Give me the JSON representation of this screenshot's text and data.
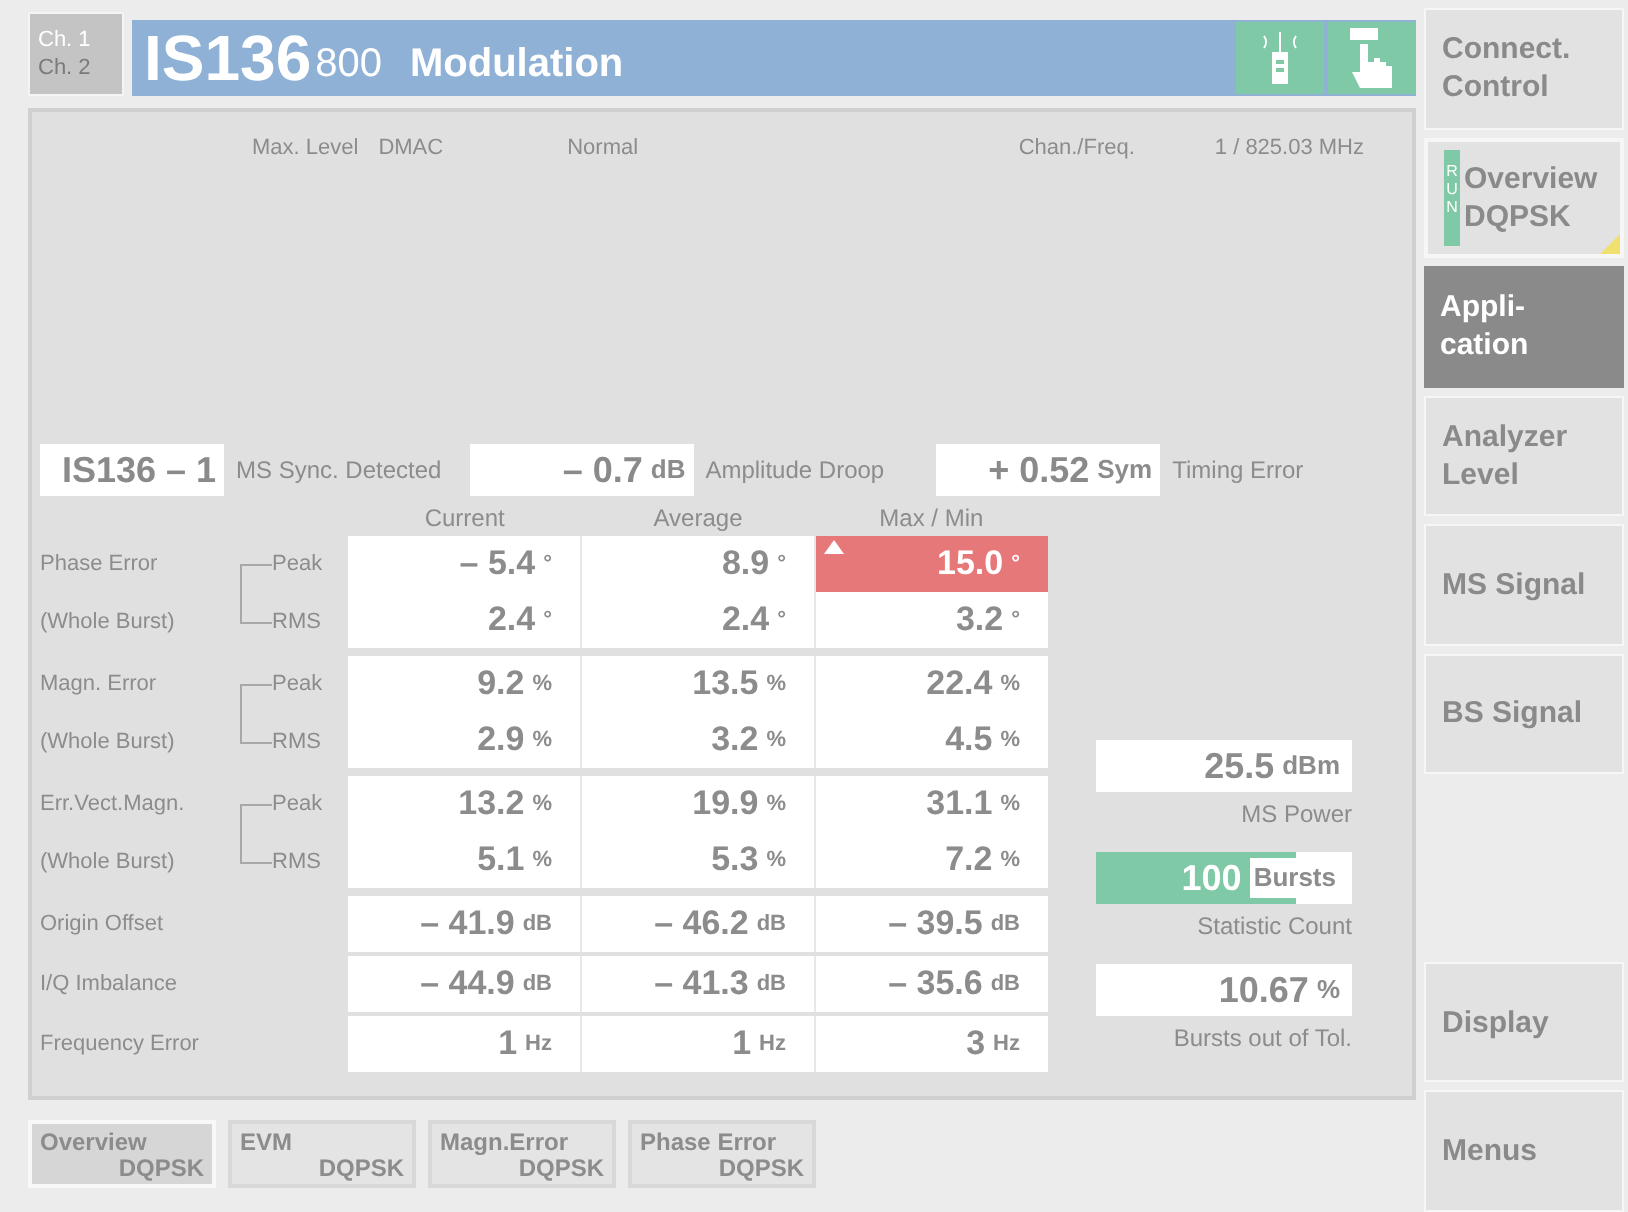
{
  "channels": [
    {
      "label": "Ch. 1",
      "selected": true
    },
    {
      "label": "Ch. 2",
      "selected": false
    }
  ],
  "title": {
    "standard": "IS136",
    "band": "800",
    "mode": "Modulation"
  },
  "info": [
    {
      "label": "Max. Level",
      "value": "DMAC"
    },
    {
      "value": "Normal"
    },
    {
      "label": "Chan./Freq.",
      "value": "1 / 825.03 MHz"
    }
  ],
  "status_line": [
    {
      "value": "IS136 – 1",
      "caption": "MS Sync. Detected"
    },
    {
      "value": "– 0.7",
      "unit": "dB",
      "caption": "Amplitude Droop"
    },
    {
      "value": "+ 0.52",
      "unit": "Sym",
      "caption": "Timing Error"
    }
  ],
  "columns": [
    "Current",
    "Average",
    "Max / Min"
  ],
  "groups": [
    {
      "kind": "pair",
      "label": "Phase Error",
      "sublabel": "(Whole Burst)",
      "rows": [
        {
          "type": "Peak",
          "cells": [
            {
              "value": "– 5.4",
              "unit": "°",
              "alarm": false
            },
            {
              "value": "8.9",
              "unit": "°",
              "alarm": false
            },
            {
              "value": "15.0",
              "unit": "°",
              "alarm": true
            }
          ]
        },
        {
          "type": "RMS",
          "cells": [
            {
              "value": "2.4",
              "unit": "°",
              "alarm": false
            },
            {
              "value": "2.4",
              "unit": "°",
              "alarm": false
            },
            {
              "value": "3.2",
              "unit": "°",
              "alarm": false
            }
          ]
        }
      ]
    },
    {
      "kind": "pair",
      "label": "Magn. Error",
      "sublabel": "(Whole Burst)",
      "rows": [
        {
          "type": "Peak",
          "cells": [
            {
              "value": "9.2",
              "unit": "%",
              "alarm": false
            },
            {
              "value": "13.5",
              "unit": "%",
              "alarm": false
            },
            {
              "value": "22.4",
              "unit": "%",
              "alarm": false
            }
          ]
        },
        {
          "type": "RMS",
          "cells": [
            {
              "value": "2.9",
              "unit": "%",
              "alarm": false
            },
            {
              "value": "3.2",
              "unit": "%",
              "alarm": false
            },
            {
              "value": "4.5",
              "unit": "%",
              "alarm": false
            }
          ]
        }
      ]
    },
    {
      "kind": "pair",
      "label": "Err.Vect.Magn.",
      "sublabel": "(Whole Burst)",
      "rows": [
        {
          "type": "Peak",
          "cells": [
            {
              "value": "13.2",
              "unit": "%",
              "alarm": false
            },
            {
              "value": "19.9",
              "unit": "%",
              "alarm": false
            },
            {
              "value": "31.1",
              "unit": "%",
              "alarm": false
            }
          ]
        },
        {
          "type": "RMS",
          "cells": [
            {
              "value": "5.1",
              "unit": "%",
              "alarm": false
            },
            {
              "value": "5.3",
              "unit": "%",
              "alarm": false
            },
            {
              "value": "7.2",
              "unit": "%",
              "alarm": false
            }
          ]
        }
      ]
    },
    {
      "kind": "single",
      "label": "Origin Offset",
      "cells": [
        {
          "value": "– 41.9",
          "unit": "dB",
          "alarm": false
        },
        {
          "value": "– 46.2",
          "unit": "dB",
          "alarm": false
        },
        {
          "value": "– 39.5",
          "unit": "dB",
          "alarm": false
        }
      ]
    },
    {
      "kind": "single",
      "label": "I/Q Imbalance",
      "cells": [
        {
          "value": "– 44.9",
          "unit": "dB",
          "alarm": false
        },
        {
          "value": "– 41.3",
          "unit": "dB",
          "alarm": false
        },
        {
          "value": "– 35.6",
          "unit": "dB",
          "alarm": false
        }
      ]
    },
    {
      "kind": "single",
      "label": "Frequency Error",
      "cells": [
        {
          "value": "1",
          "unit": "Hz",
          "alarm": false
        },
        {
          "value": "1",
          "unit": "Hz",
          "alarm": false
        },
        {
          "value": "3",
          "unit": "Hz",
          "alarm": false
        }
      ]
    }
  ],
  "side_readings": [
    {
      "kind": "box",
      "value": "25.5",
      "unit": "dBm",
      "label": "MS Power"
    },
    {
      "kind": "counter",
      "value": "100",
      "unit": "Bursts",
      "label": "Statistic Count",
      "level": 0.78
    },
    {
      "kind": "box",
      "value": "10.67",
      "unit": "%",
      "label": "Bursts out of Tol."
    }
  ],
  "tabs": [
    {
      "line1": "Overview",
      "line2": "DQPSK",
      "selected": true
    },
    {
      "line1": "EVM",
      "line2": "DQPSK",
      "selected": false
    },
    {
      "line1": "Magn.Error",
      "line2": "DQPSK",
      "selected": false
    },
    {
      "line1": "Phase Error",
      "line2": "DQPSK",
      "selected": false
    }
  ],
  "softkeys": [
    {
      "lines": [
        "Connect.",
        "Control"
      ],
      "kind": "key",
      "selected": false
    },
    {
      "lines": [
        "Overview",
        "DQPSK"
      ],
      "kind": "status",
      "run": "RUN",
      "selected": false
    },
    {
      "lines": [
        "Appli-",
        "cation"
      ],
      "kind": "key",
      "selected": true
    },
    {
      "lines": [
        "Analyzer",
        "Level"
      ],
      "kind": "key",
      "selected": false
    },
    {
      "lines": [
        "MS Signal"
      ],
      "kind": "key",
      "selected": false
    },
    {
      "lines": [
        "BS Signal"
      ],
      "kind": "key",
      "selected": false
    },
    {
      "kind": "gap"
    },
    {
      "lines": [
        "Display"
      ],
      "kind": "key",
      "selected": false
    },
    {
      "lines": [
        "Menus"
      ],
      "kind": "key",
      "selected": false
    }
  ]
}
